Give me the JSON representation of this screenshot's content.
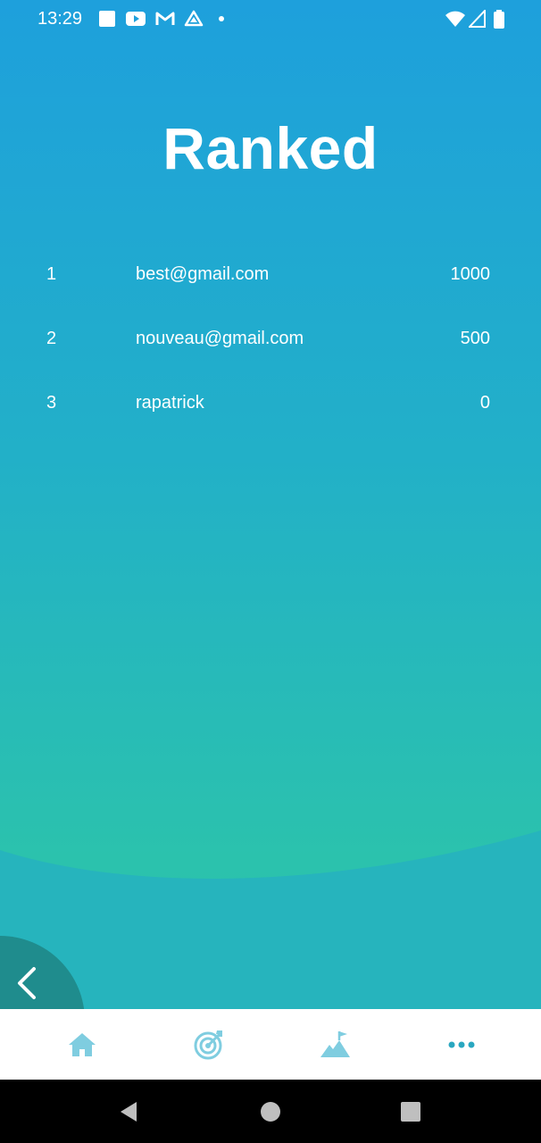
{
  "status_bar": {
    "time": "13:29",
    "left_icons": [
      "square-notification-icon",
      "youtube-icon",
      "gmail-icon",
      "drive-icon",
      "dot-icon"
    ],
    "right_icons": [
      "wifi-icon",
      "cellular-signal-icon",
      "battery-icon"
    ]
  },
  "page": {
    "title": "Ranked"
  },
  "ranking": [
    {
      "position": "1",
      "name": "best@gmail.com",
      "score": "1000"
    },
    {
      "position": "2",
      "name": "nouveau@gmail.com",
      "score": "500"
    },
    {
      "position": "3",
      "name": "rapatrick",
      "score": "0"
    }
  ],
  "back_button": {
    "icon": "chevron-left-icon"
  },
  "bottom_nav": {
    "items": [
      {
        "icon": "home-icon"
      },
      {
        "icon": "target-icon"
      },
      {
        "icon": "mountain-flag-icon"
      },
      {
        "icon": "more-dots-icon"
      }
    ],
    "color": "#7fcde0",
    "active_color": "#2aa7c0"
  },
  "system_nav": {
    "items": [
      "back-triangle-icon",
      "home-circle-icon",
      "recents-square-icon"
    ]
  },
  "colors": {
    "gradient_top": "#1ea0dc",
    "gradient_bottom": "#2cc2aa",
    "wave": "#26b4bd",
    "back_button": "#1f8c8d"
  }
}
